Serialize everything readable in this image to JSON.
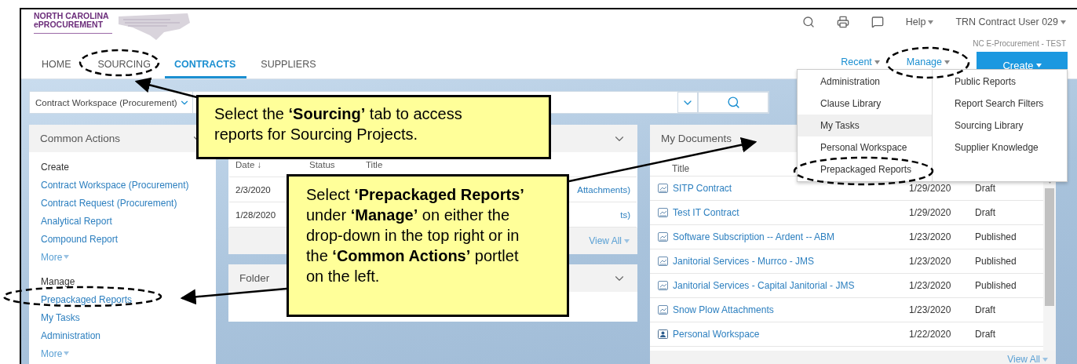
{
  "header": {
    "logo_lines": [
      "NORTH CAROLINA",
      "ePROCUREMENT"
    ],
    "help": "Help",
    "user": "TRN Contract User 029",
    "environment": "NC E-Procurement - TEST"
  },
  "tabs": [
    {
      "label": "HOME",
      "selected": false
    },
    {
      "label": "SOURCING",
      "selected": false
    },
    {
      "label": "CONTRACTS",
      "selected": true
    },
    {
      "label": "SUPPLIERS",
      "selected": false
    }
  ],
  "actions": [
    {
      "label": "Recent",
      "kind": "link"
    },
    {
      "label": "Manage",
      "kind": "link"
    },
    {
      "label": "Create",
      "kind": "button"
    }
  ],
  "manage_menu": {
    "columns": [
      [
        {
          "label": "Administration",
          "highlighted": false
        },
        {
          "label": "Clause Library",
          "highlighted": false
        },
        {
          "label": "My Tasks",
          "highlighted": true
        },
        {
          "label": "Personal Workspace",
          "highlighted": false
        },
        {
          "label": "Prepackaged Reports",
          "highlighted": false
        }
      ],
      [
        {
          "label": "Public Reports",
          "highlighted": false
        },
        {
          "label": "Report Search Filters",
          "highlighted": false
        },
        {
          "label": "Sourcing Library",
          "highlighted": false
        },
        {
          "label": "Supplier Knowledge",
          "highlighted": false
        }
      ]
    ]
  },
  "search": {
    "scope": "Contract Workspace (Procurement)"
  },
  "common_actions": {
    "title": "Common Actions",
    "sections": [
      {
        "heading": "Create",
        "links": [
          "Contract Workspace (Procurement)",
          "Contract Request (Procurement)",
          "Analytical Report",
          "Compound Report"
        ],
        "more": "More"
      },
      {
        "heading": "Manage",
        "links": [
          "Prepackaged Reports",
          "My Tasks",
          "Administration"
        ],
        "more": "More"
      }
    ]
  },
  "recent_panel": {
    "columns": [
      "Date ↓",
      "Status",
      "Title"
    ],
    "rows": [
      {
        "date": "2/3/2020",
        "title": "Attachments)"
      },
      {
        "date": "1/28/2020",
        "title": "ts)"
      }
    ],
    "view_all": "View All"
  },
  "folder_panel": {
    "title": "Folder"
  },
  "my_documents": {
    "title": "My Documents",
    "column": "Title",
    "rows": [
      {
        "kind": "contract",
        "title": "SITP Contract",
        "date": "1/29/2020",
        "status": "Draft"
      },
      {
        "kind": "contract",
        "title": "Test IT Contract",
        "date": "1/29/2020",
        "status": "Draft"
      },
      {
        "kind": "contract",
        "title": "Software Subscription -- Ardent -- ABM",
        "date": "1/23/2020",
        "status": "Published"
      },
      {
        "kind": "contract",
        "title": "Janitorial Services - Murrco - JMS",
        "date": "1/23/2020",
        "status": "Published"
      },
      {
        "kind": "contract",
        "title": "Janitorial Services - Capital Janitorial - JMS",
        "date": "1/23/2020",
        "status": "Published"
      },
      {
        "kind": "contract",
        "title": "Snow Plow Attachments",
        "date": "1/23/2020",
        "status": "Draft"
      },
      {
        "kind": "workspace",
        "title": "Personal Workspace",
        "date": "1/22/2020",
        "status": "Draft"
      }
    ],
    "view_all": "View All"
  },
  "callouts": [
    {
      "text": "Select the **‘Sourcing’** tab to access reports for Sourcing Projects."
    },
    {
      "text": "Select **‘Prepackaged Reports’** under **‘Manage’** on either the drop-down in the top right or in the **‘Common Actions’** portlet on the left."
    }
  ]
}
